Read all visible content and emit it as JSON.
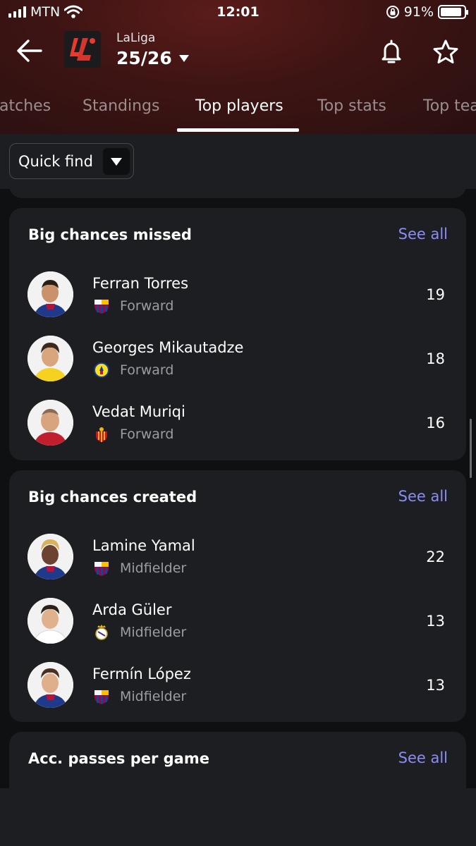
{
  "status_bar": {
    "carrier": "MTN",
    "time": "12:01",
    "battery": "91%",
    "battery_level": 0.91
  },
  "header": {
    "league": "LaLiga",
    "season": "25/26"
  },
  "tabs": [
    {
      "label": "atches"
    },
    {
      "label": "Standings"
    },
    {
      "label": "Top players",
      "active": true
    },
    {
      "label": "Top stats"
    },
    {
      "label": "Top tea"
    }
  ],
  "filter": {
    "quick_find": "Quick find"
  },
  "sections": [
    {
      "title": "Big chances missed",
      "see_all": "See all",
      "players": [
        {
          "name": "Ferran Torres",
          "position": "Forward",
          "value": "19",
          "club": "barcelona"
        },
        {
          "name": "Georges Mikautadze",
          "position": "Forward",
          "value": "18",
          "club": "villarreal"
        },
        {
          "name": "Vedat Muriqi",
          "position": "Forward",
          "value": "16",
          "club": "mallorca"
        }
      ]
    },
    {
      "title": "Big chances created",
      "see_all": "See all",
      "players": [
        {
          "name": "Lamine Yamal",
          "position": "Midfielder",
          "value": "22",
          "club": "barcelona"
        },
        {
          "name": "Arda Güler",
          "position": "Midfielder",
          "value": "13",
          "club": "real-madrid"
        },
        {
          "name": "Fermín López",
          "position": "Midfielder",
          "value": "13",
          "club": "barcelona"
        }
      ]
    },
    {
      "title": "Acc. passes per game",
      "see_all": "See all",
      "players": []
    }
  ],
  "colors": {
    "accent": "#8c8cf4",
    "header": "#3d1413",
    "card": "#1c1e21",
    "background": "#0f1012"
  }
}
